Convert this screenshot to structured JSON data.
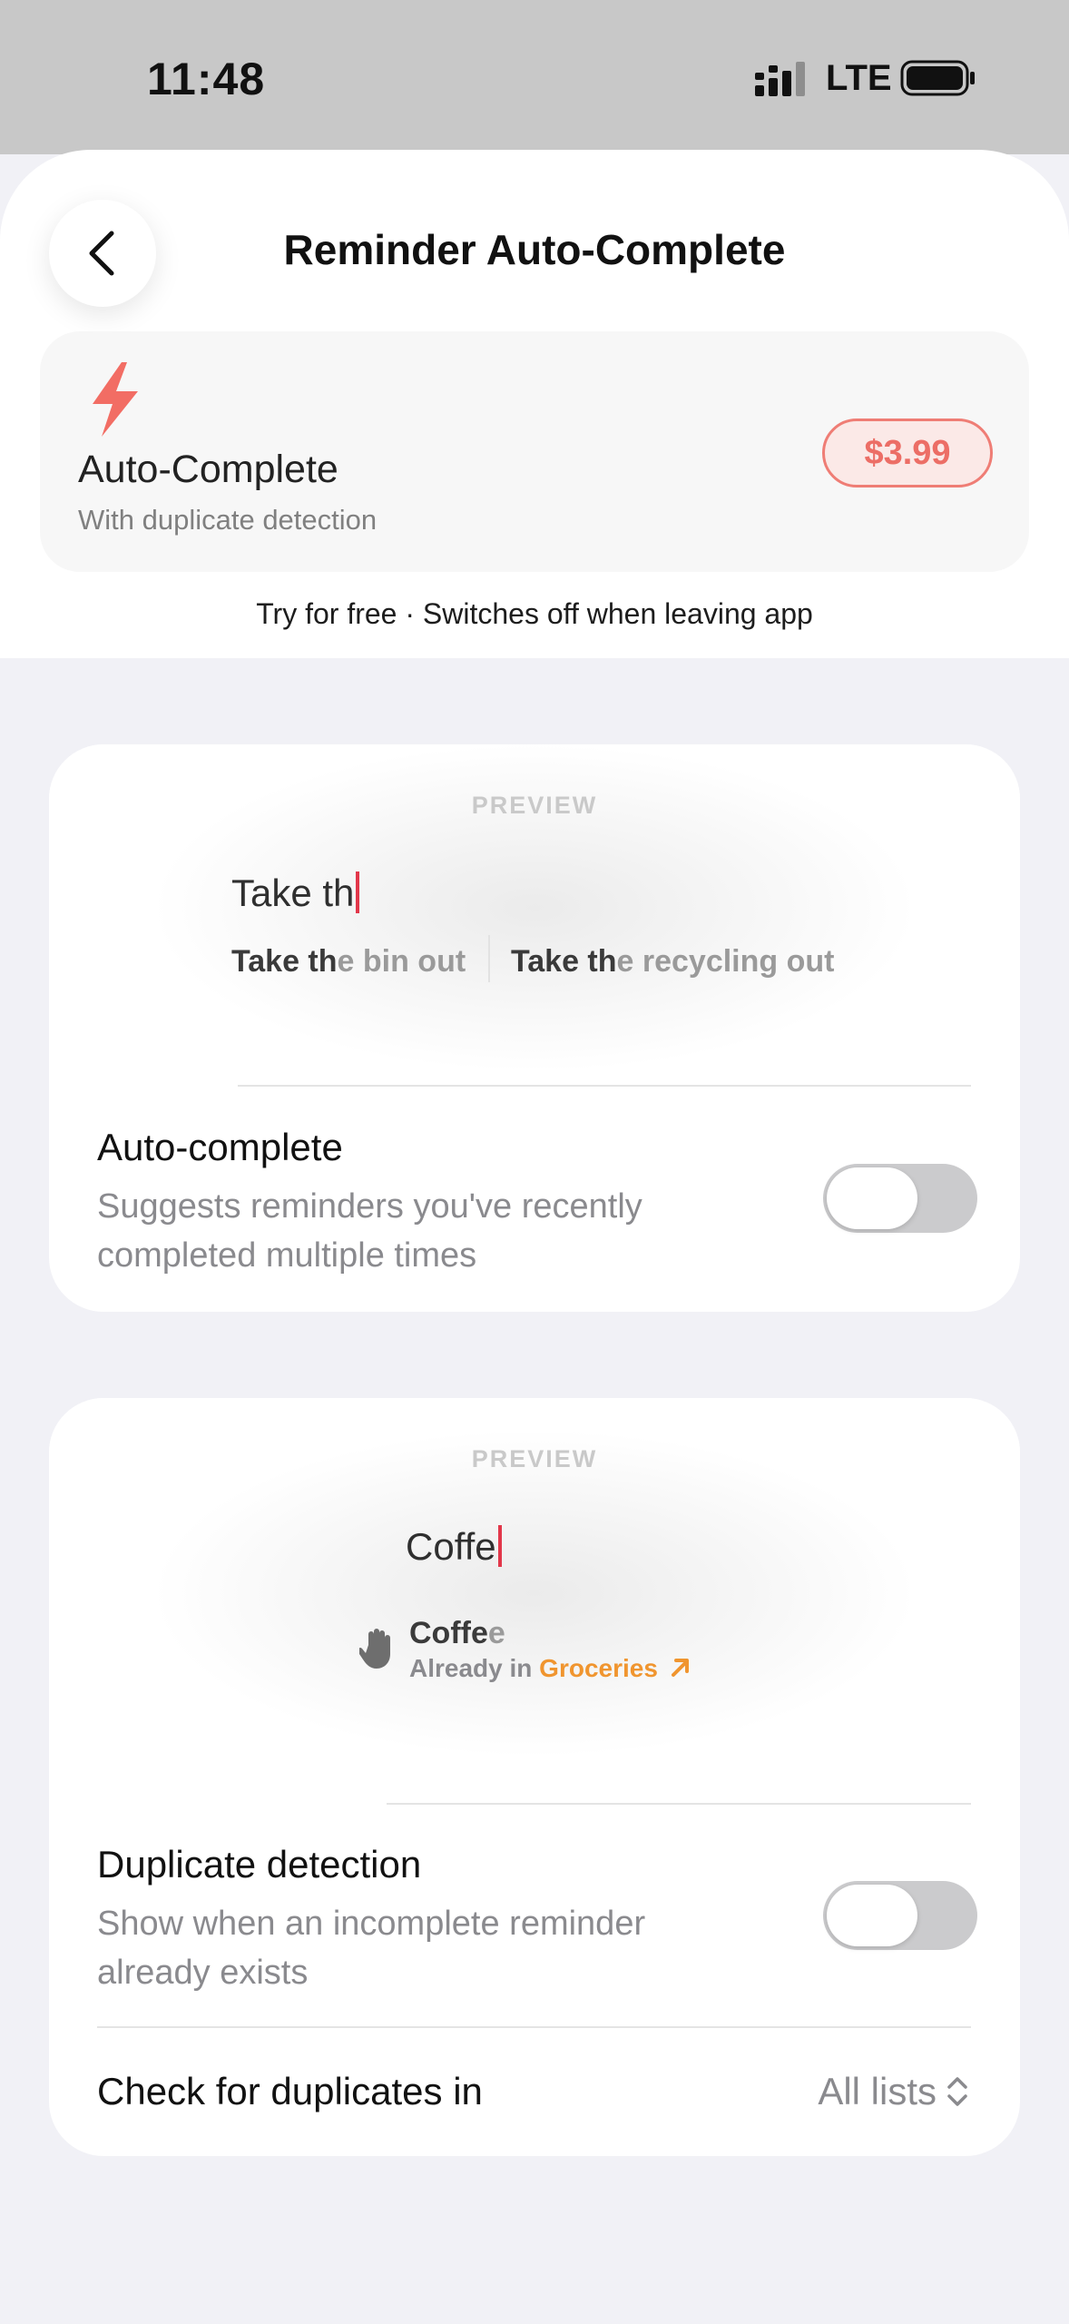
{
  "status_bar": {
    "time": "11:48",
    "network": "LTE"
  },
  "header": {
    "title": "Reminder Auto-Complete",
    "back_icon": "chevron-left-icon"
  },
  "product": {
    "icon": "bolt-icon",
    "name": "Auto-Complete",
    "subtitle": "With duplicate detection",
    "price": "$3.99",
    "trial_note": "Try for free · Switches off when leaving app"
  },
  "autocomplete_card": {
    "preview_label": "PREVIEW",
    "typed_text": "Take th",
    "suggestions": [
      {
        "typed": "Take th",
        "rest": "e bin out"
      },
      {
        "typed": "Take th",
        "rest": "e recycling out"
      }
    ],
    "setting_title": "Auto-complete",
    "setting_desc": "Suggests reminders you've recently completed multiple times",
    "toggle_on": false
  },
  "duplicate_card": {
    "preview_label": "PREVIEW",
    "typed_text": "Coffe",
    "match": {
      "icon": "hand-stop-icon",
      "typed": "Coffe",
      "rest": "e",
      "sub_prefix": "Already in ",
      "list_name": "Groceries",
      "link_icon": "arrow-up-right-icon"
    },
    "setting_title": "Duplicate detection",
    "setting_desc": "Show when an incomplete reminder already exists",
    "toggle_on": false,
    "check_label": "Check for duplicates in",
    "check_value": "All lists"
  },
  "colors": {
    "accent_red": "#ec6e66",
    "caret": "#e2374a",
    "link_orange": "#f0952f",
    "background": "#f1f1f6"
  }
}
